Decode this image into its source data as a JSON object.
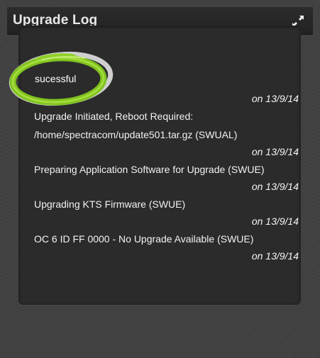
{
  "panel": {
    "title": "Upgrade Log",
    "status": "sucessful"
  },
  "entries": [
    {
      "date": "on 13/9/14",
      "message": "Upgrade Initiated, Reboot Required: /home/spectracom/update501.tar.gz (SWUAL)"
    },
    {
      "date": "on 13/9/14",
      "message": "Preparing Application Software for Upgrade (SWUE)"
    },
    {
      "date": "on 13/9/14",
      "message": "Upgrading KTS Firmware (SWUE)"
    },
    {
      "date": "on 13/9/14",
      "message": "OC 6 ID FF 0000 - No Upgrade Available (SWUE)"
    },
    {
      "date": "on 13/9/14",
      "message": ""
    }
  ],
  "colors": {
    "ring_outer": "#d2d2d2",
    "ring_green": "#7fc31f",
    "ring_green_light": "#a6dc3c"
  },
  "icons": {
    "expand": "expand-icon"
  }
}
